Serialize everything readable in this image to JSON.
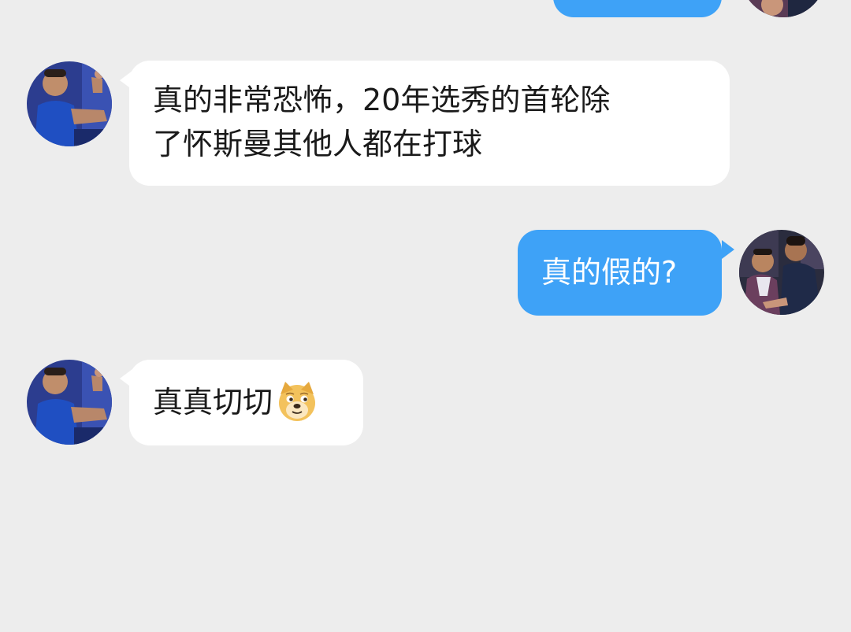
{
  "messages": [
    {
      "side": "out",
      "text": ""
    },
    {
      "side": "in",
      "line1": "真的非常恐怖，20年选秀的首轮除",
      "line2": "了怀斯曼其他人都在打球"
    },
    {
      "side": "out",
      "text": "真的假的?"
    },
    {
      "side": "in",
      "text": "真真切切",
      "emoji": "doge-emoji"
    }
  ],
  "colors": {
    "background": "#ededed",
    "incoming_bubble": "#ffffff",
    "outgoing_bubble": "#3ea2f7"
  }
}
